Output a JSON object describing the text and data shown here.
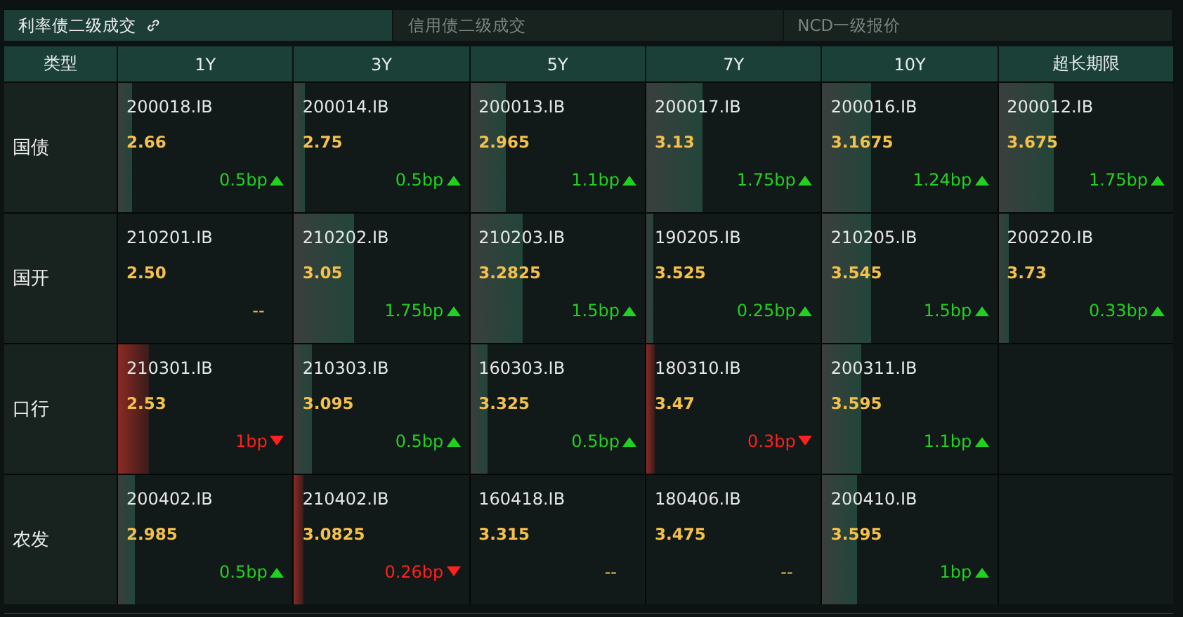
{
  "tabs": [
    {
      "label": "利率债二级成交",
      "selected": true,
      "link_icon": true
    },
    {
      "label": "信用债二级成交",
      "selected": false
    },
    {
      "label": "NCD一级报价",
      "selected": false
    }
  ],
  "table": {
    "columns": [
      "类型",
      "1Y",
      "3Y",
      "5Y",
      "7Y",
      "10Y",
      "超长期限"
    ],
    "rows": [
      {
        "cells": [
          {
            "kind": "type",
            "label": "国债"
          },
          {
            "kind": "rise",
            "code": "200018.IB",
            "yield": "2.66",
            "change": "0.5bp",
            "level": 0.08
          },
          {
            "kind": "rise",
            "code": "200014.IB",
            "yield": "2.75",
            "change": "0.5bp",
            "level": 0.06
          },
          {
            "kind": "rise",
            "code": "200013.IB",
            "yield": "2.965",
            "change": "1.1bp",
            "level": 0.2
          },
          {
            "kind": "rise",
            "code": "200017.IB",
            "yield": "3.13",
            "change": "1.75bp",
            "level": 0.32
          },
          {
            "kind": "rise",
            "code": "200016.IB",
            "yield": "3.1675",
            "change": "1.24bp",
            "level": 0.28
          },
          {
            "kind": "rise",
            "code": "200012.IB",
            "yield": "3.675",
            "change": "1.75bp",
            "level": 0.32
          }
        ]
      },
      {
        "cells": [
          {
            "kind": "type",
            "label": "国开"
          },
          {
            "kind": "flat",
            "code": "210201.IB",
            "yield": "2.50",
            "change": "--"
          },
          {
            "kind": "rise",
            "code": "210202.IB",
            "yield": "3.05",
            "change": "1.75bp",
            "level": 0.34
          },
          {
            "kind": "rise",
            "code": "210203.IB",
            "yield": "3.2825",
            "change": "1.5bp",
            "level": 0.3
          },
          {
            "kind": "rise",
            "code": "190205.IB",
            "yield": "3.525",
            "change": "0.25bp",
            "level": 0.04
          },
          {
            "kind": "rise",
            "code": "210205.IB",
            "yield": "3.545",
            "change": "1.5bp",
            "level": 0.28
          },
          {
            "kind": "rise",
            "code": "200220.IB",
            "yield": "3.73",
            "change": "0.33bp",
            "level": 0.06
          }
        ]
      },
      {
        "cells": [
          {
            "kind": "type",
            "label": "口行"
          },
          {
            "kind": "fall",
            "code": "210301.IB",
            "yield": "2.53",
            "change": "1bp",
            "level": 0.18
          },
          {
            "kind": "rise",
            "code": "210303.IB",
            "yield": "3.095",
            "change": "0.5bp",
            "level": 0.1
          },
          {
            "kind": "rise",
            "code": "160303.IB",
            "yield": "3.325",
            "change": "0.5bp",
            "level": 0.1
          },
          {
            "kind": "fall",
            "code": "180310.IB",
            "yield": "3.47",
            "change": "0.3bp",
            "level": 0.05
          },
          {
            "kind": "rise",
            "code": "200311.IB",
            "yield": "3.595",
            "change": "1.1bp",
            "level": 0.22
          },
          {
            "kind": "empty"
          }
        ]
      },
      {
        "cells": [
          {
            "kind": "type",
            "label": "农发"
          },
          {
            "kind": "rise",
            "code": "200402.IB",
            "yield": "2.985",
            "change": "0.5bp",
            "level": 0.1
          },
          {
            "kind": "fall",
            "code": "210402.IB",
            "yield": "3.0825",
            "change": "0.26bp",
            "level": 0.05
          },
          {
            "kind": "flat",
            "code": "160418.IB",
            "yield": "3.315",
            "change": "--"
          },
          {
            "kind": "flat",
            "code": "180406.IB",
            "yield": "3.475",
            "change": "--"
          },
          {
            "kind": "rise",
            "code": "200410.IB",
            "yield": "3.595",
            "change": "1bp",
            "level": 0.2
          },
          {
            "kind": "empty"
          }
        ]
      }
    ]
  }
}
